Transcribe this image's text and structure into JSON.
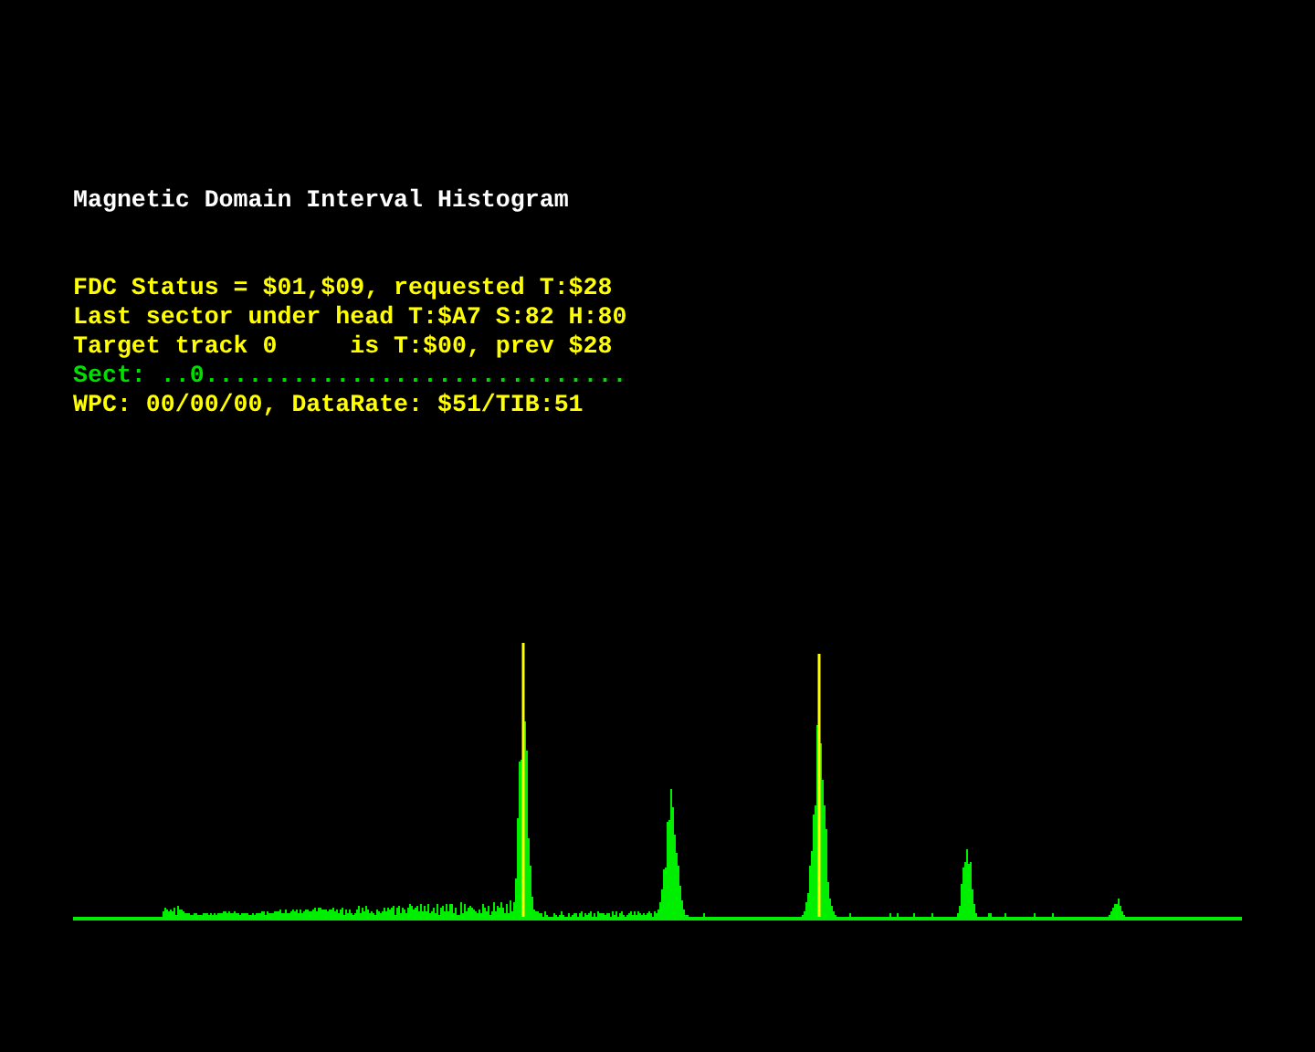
{
  "title": "Magnetic Domain Interval Histogram",
  "status_lines": [
    {
      "text": "FDC Status = $01,$09, requested T:$28",
      "color": "#ffff00"
    },
    {
      "text": "Last sector under head T:$A7 S:82 H:80",
      "color": "#ffff00"
    },
    {
      "text": "Target track 0     is T:$00, prev $28",
      "color": "#ffff00"
    },
    {
      "text": "Sect: ..0.............................",
      "color": "#00e000"
    },
    {
      "text": "WPC: 00/00/00, DataRate: $51/TIB:51",
      "color": "#ffff00"
    }
  ]
}
